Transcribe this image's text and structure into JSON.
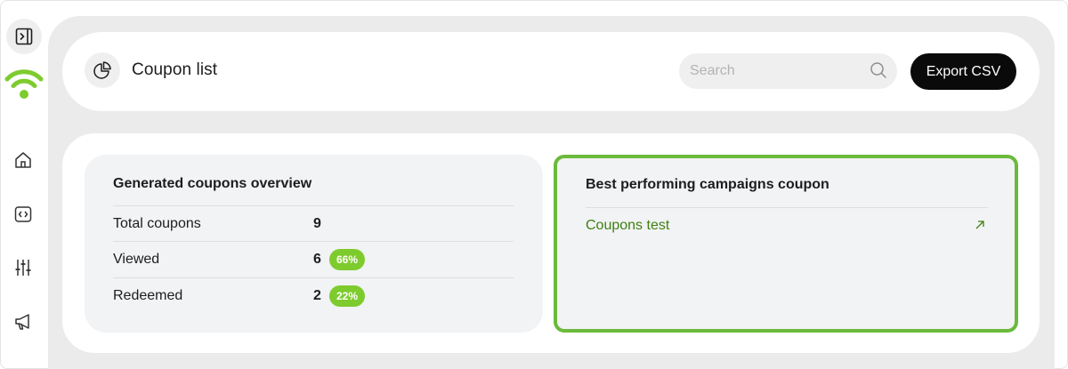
{
  "app": {
    "page_title": "Coupon list"
  },
  "sidebar": {
    "items": [
      {
        "icon": "home-icon"
      },
      {
        "icon": "code-icon"
      },
      {
        "icon": "sliders-icon"
      },
      {
        "icon": "megaphone-icon"
      }
    ]
  },
  "header": {
    "search_placeholder": "Search",
    "search_value": "",
    "export_label": "Export CSV"
  },
  "overview": {
    "title": "Generated coupons overview",
    "rows": [
      {
        "label": "Total coupons",
        "value": "9",
        "badge": ""
      },
      {
        "label": "Viewed",
        "value": "6",
        "badge": "66%"
      },
      {
        "label": "Redeemed",
        "value": "2",
        "badge": "22%"
      }
    ]
  },
  "best": {
    "title": "Best performing campaigns coupon",
    "items": [
      {
        "label": "Coupons test"
      }
    ]
  },
  "colors": {
    "accent_green": "#7ecb2e",
    "highlight_border": "#6cba3c",
    "link_green": "#3f7f12",
    "button_dark": "#0a0a0a"
  }
}
